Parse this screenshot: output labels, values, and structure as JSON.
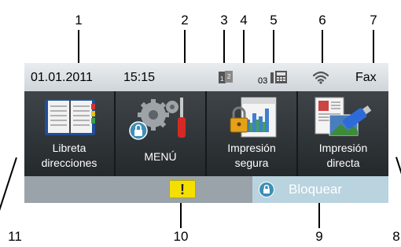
{
  "callouts": {
    "c1": "1",
    "c2": "2",
    "c3": "3",
    "c4": "4",
    "c5": "5",
    "c6": "6",
    "c7": "7",
    "c8": "8",
    "c9": "9",
    "c10": "10",
    "c11": "11"
  },
  "status": {
    "date": "01.01.2011",
    "time": "15:15",
    "duplex_icon": "duplex-12-icon",
    "fax_memory_count": "03",
    "fax_memory_icon": "fax-memory-icon",
    "wifi_icon": "wifi-icon",
    "mode": "Fax"
  },
  "tiles": {
    "address_book": {
      "line1": "Libreta",
      "line2": "direcciones",
      "icon": "address-book-icon"
    },
    "menu": {
      "label": "MENÚ",
      "icon": "settings-gear-icon"
    },
    "secure_print": {
      "line1": "Impresión",
      "line2": "segura",
      "icon": "secure-print-icon"
    },
    "direct_print": {
      "line1": "Impresión",
      "line2": "directa",
      "icon": "usb-direct-print-icon"
    }
  },
  "bottom": {
    "warning_glyph": "!",
    "lock_label": "Bloquear",
    "lock_icon": "lock-icon"
  },
  "colors": {
    "screen_bg": "#d8dde2",
    "tile_bg": "#2d3236",
    "warning": "#f4e000",
    "lock_button": "#b9d3df"
  }
}
